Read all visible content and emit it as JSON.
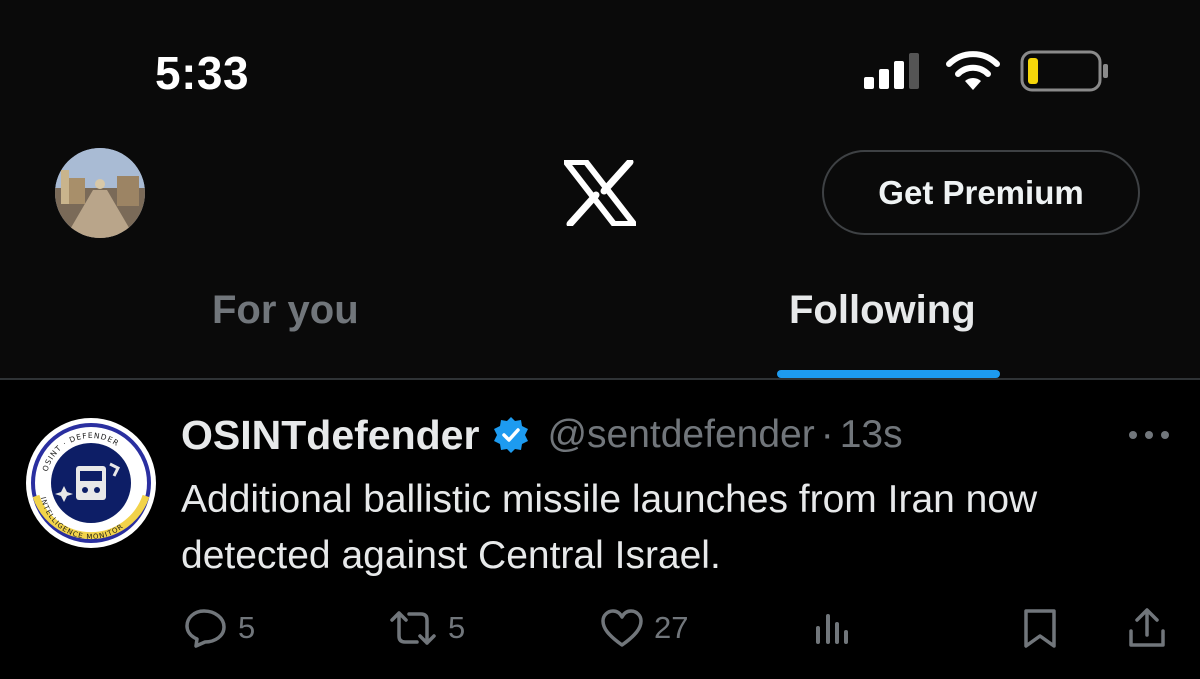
{
  "status_bar": {
    "time": "5:33"
  },
  "header": {
    "logo": "x-logo",
    "premium_label": "Get Premium",
    "tabs": [
      {
        "label": "For you",
        "active": false
      },
      {
        "label": "Following",
        "active": true
      }
    ],
    "accent_color": "#1d9bf0"
  },
  "tweet": {
    "author_name": "OSINTdefender",
    "verified": true,
    "handle": "@sentdefender",
    "separator": "·",
    "time": "13s",
    "avatar_ring_text_top": "OSINT · DEFENDER",
    "avatar_ring_text_bottom": "INTELLIGENCE MONITOR",
    "text": "Additional ballistic missile launches from Iran now detected against Central Israel.",
    "actions": {
      "replies": "5",
      "reposts": "5",
      "likes": "27"
    }
  },
  "icons": [
    "signal-icon",
    "wifi-icon",
    "battery-icon",
    "verified-icon",
    "more-icon",
    "reply-icon",
    "retweet-icon",
    "like-icon",
    "views-icon",
    "bookmark-icon",
    "share-icon"
  ]
}
